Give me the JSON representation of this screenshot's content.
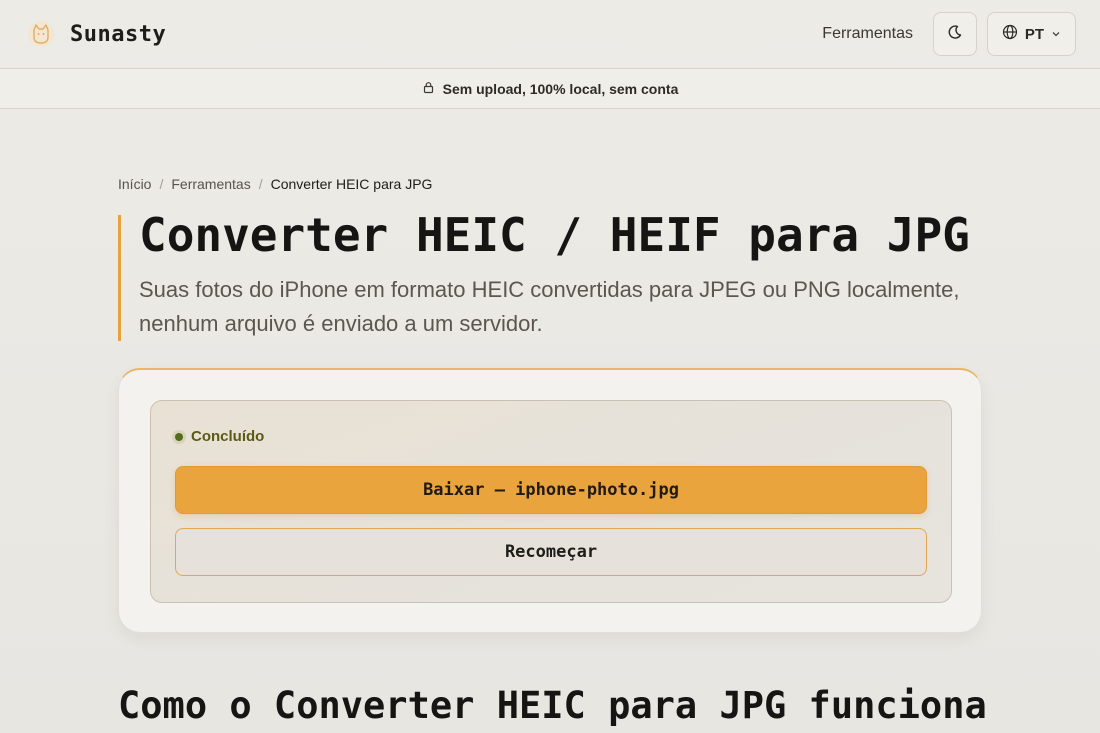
{
  "header": {
    "brand_name": "Sunasty",
    "nav_tools": "Ferramentas",
    "language": "PT"
  },
  "banner": {
    "text": "Sem upload, 100% local, sem conta"
  },
  "breadcrumb": {
    "home": "Início",
    "separator": "/",
    "tools": "Ferramentas",
    "current": "Converter HEIC para JPG"
  },
  "main": {
    "title": "Converter HEIC / HEIF para JPG",
    "subtitle": "Suas fotos do iPhone em formato HEIC convertidas para JPEG ou PNG localmente, nenhum arquivo é enviado a um servidor."
  },
  "result": {
    "status": "Concluído",
    "download_label": "Baixar — iphone-photo.jpg",
    "restart_label": "Recomeçar"
  },
  "section": {
    "heading": "Como o Converter HEIC para JPG funciona"
  },
  "colors": {
    "accent": "#eaa43e",
    "status_green": "#556b1f"
  },
  "icons": [
    "cat-logo-icon",
    "moon-icon",
    "globe-icon",
    "chevron-down-icon",
    "lock-icon"
  ]
}
